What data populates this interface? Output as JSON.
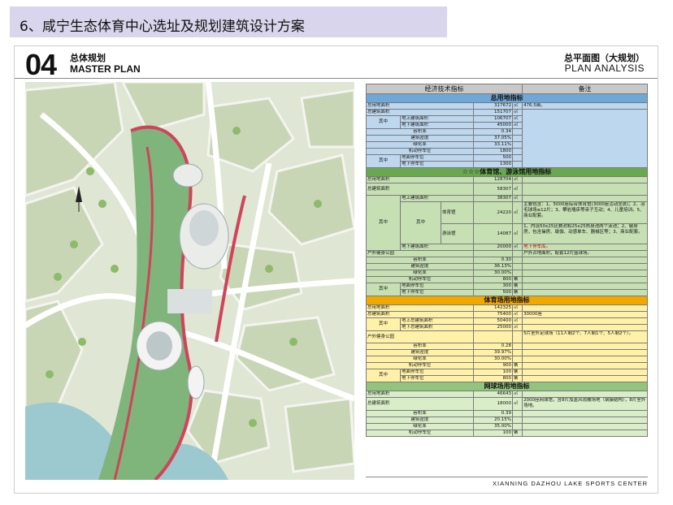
{
  "header": {
    "section_title": "6、咸宁生态体育中心选址及规划建筑设计方案"
  },
  "slide": {
    "number": "04",
    "title_cn": "总体规划",
    "title_en": "MASTER PLAN",
    "right_title_cn": "总平面图（大规划）",
    "right_title_en": "PLAN ANALYSIS",
    "footer": "XIANNING DAZHOU LAKE SPORTS CENTER"
  },
  "table": {
    "col_header_main": "经济技术指标",
    "col_header_note": "备注",
    "s1": {
      "title": "总用地指标",
      "r1": {
        "label": "总用地面积",
        "value": "317672",
        "unit": "㎡",
        "note": "476.5亩。"
      },
      "r2": {
        "label": "总建筑面积",
        "value": "151707",
        "unit": "㎡"
      },
      "r3": {
        "label": "其中",
        "a_label": "地上建筑面积",
        "a_value": "106707",
        "a_unit": "㎡",
        "b_label": "地下建筑面积",
        "b_value": "45000",
        "b_unit": "㎡"
      },
      "r4": {
        "label": "容积率",
        "value": "0.34"
      },
      "r5": {
        "label": "建筑密度",
        "value": "37.05%"
      },
      "r6": {
        "label": "绿化率",
        "value": "33.11%"
      },
      "r7": {
        "label": "机动停车位",
        "value": "1800"
      },
      "r8": {
        "label": "其中",
        "a_label": "地面停车位",
        "a_value": "500",
        "b_label": "地下停车位",
        "b_value": "1300"
      }
    },
    "s2": {
      "title": "☆☆☆体育馆、游泳馆用地指标",
      "r1": {
        "label": "总用地面积",
        "value": "128704",
        "unit": "㎡"
      },
      "r2": {
        "label": "总建筑面积",
        "value": "58307",
        "unit": "㎡"
      },
      "r3": {
        "label": "其中",
        "above_label": "地上建筑面积",
        "above_value": "38307",
        "above_unit": "㎡",
        "mid": "其中",
        "gym_label": "体育馆",
        "gym_value": "24220",
        "gym_unit": "㎡",
        "pool_label": "游泳馆",
        "pool_value": "14087",
        "pool_unit": "㎡",
        "under_label": "地下建筑面积",
        "under_value": "20000",
        "under_unit": "㎡",
        "note1": "主要包含：1、5000座综合体育馆(3000座活动坐席)；2、羽毛球场≥12片；3、攀岩墙床等亲子互动；4、儿童培训。5、商业配套。",
        "note2": "1、内设50x25比赛池和25x25热身池两个泳池；2、健身房，包含操房、瑜伽、动感单车、器械区等；3、商业配套。",
        "note3": "地下停车库。"
      },
      "r4": {
        "label": "户外健身公园",
        "note": "户外占地面积，配套12片篮球场。"
      },
      "r5": {
        "label": "容积率",
        "value": "0.30"
      },
      "r6": {
        "label": "建筑密度",
        "value": "36.13%"
      },
      "r7": {
        "label": "绿化率",
        "value": "30.00%"
      },
      "r8": {
        "label": "机动停车位",
        "value": "800",
        "unit": "辆"
      },
      "r9": {
        "label": "其中",
        "a_label": "地面停车位",
        "a_value": "300",
        "a_unit": "辆",
        "b_label": "地下停车位",
        "b_value": "500",
        "b_unit": "辆"
      }
    },
    "s3": {
      "title": "体育场用地指标",
      "r1": {
        "label": "总用地面积",
        "value": "142325",
        "unit": "㎡"
      },
      "r2": {
        "label": "总建筑面积",
        "value": "75400",
        "unit": "㎡",
        "note": "30000座"
      },
      "r3": {
        "label": "其中",
        "a_label": "地上总建筑面积",
        "a_value": "50400",
        "a_unit": "㎡",
        "b_label": "地下总建筑面积",
        "b_value": "25000",
        "b_unit": "㎡"
      },
      "r4": {
        "label": "户外健身公园",
        "note": "5片室外足球场（11人制2个、7人制1个、5人制2个）。"
      },
      "r5": {
        "label": "容积率",
        "value": "0.28"
      },
      "r6": {
        "label": "建筑密度",
        "value": "39.97%"
      },
      "r7": {
        "label": "绿化率",
        "value": "30.00%"
      },
      "r8": {
        "label": "机动停车位",
        "value": "900",
        "unit": "辆"
      },
      "r9": {
        "label": "其中",
        "a_label": "地面停车位",
        "a_value": "100",
        "a_unit": "辆",
        "b_label": "地下停车位",
        "b_value": "800",
        "b_unit": "辆"
      }
    },
    "s4": {
      "title": "网球场用地指标",
      "r1": {
        "label": "总用地面积",
        "value": "46643",
        "unit": "㎡"
      },
      "r2": {
        "label": "总建筑面积",
        "value": "18000",
        "unit": "㎡",
        "note": "2000座网球馆，含8片加盖风雨棚场地（钢膜结构），8片室外场地。"
      },
      "r3": {
        "label": "容积率",
        "value": "0.39"
      },
      "r4": {
        "label": "建筑密度",
        "value": "20.15%"
      },
      "r5": {
        "label": "绿化率",
        "value": "35.00%"
      },
      "r6": {
        "label": "机动停车位",
        "value": "100",
        "unit": "辆"
      }
    }
  }
}
